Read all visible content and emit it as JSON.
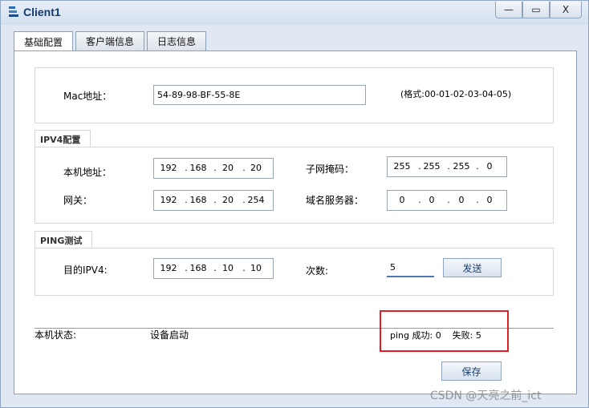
{
  "window": {
    "title": "Client1",
    "controls": {
      "minimize": "—",
      "maximize": "▭",
      "close": "X"
    }
  },
  "tabs": [
    "基础配置",
    "客户端信息",
    "日志信息"
  ],
  "mac": {
    "label": "Mac地址：",
    "value": "54-89-98-BF-55-8E",
    "hint": "(格式:00-01-02-03-04-05)"
  },
  "ipv4": {
    "group_title": "IPV4配置",
    "local_label": "本机地址：",
    "local": [
      "192",
      "168",
      "20",
      "20"
    ],
    "mask_label": "子网掩码：",
    "mask": [
      "255",
      "255",
      "255",
      "0"
    ],
    "gateway_label": "网关：",
    "gateway": [
      "192",
      "168",
      "20",
      "254"
    ],
    "dns_label": "域名服务器：",
    "dns": [
      "0",
      "0",
      "0",
      "0"
    ]
  },
  "ping": {
    "group_title": "PING测试",
    "dest_label": "目的IPV4:",
    "dest": [
      "192",
      "168",
      "10",
      "10"
    ],
    "count_label": "次数:",
    "count": "5",
    "send": "发送"
  },
  "status": {
    "label": "本机状态:",
    "value": "设备启动",
    "result": "ping 成功: 0    失败: 5"
  },
  "save": "保存",
  "watermark": "CSDN @天亮之前_ict",
  "colors": {
    "highlight": "#e02020",
    "title": "#123a6e"
  }
}
